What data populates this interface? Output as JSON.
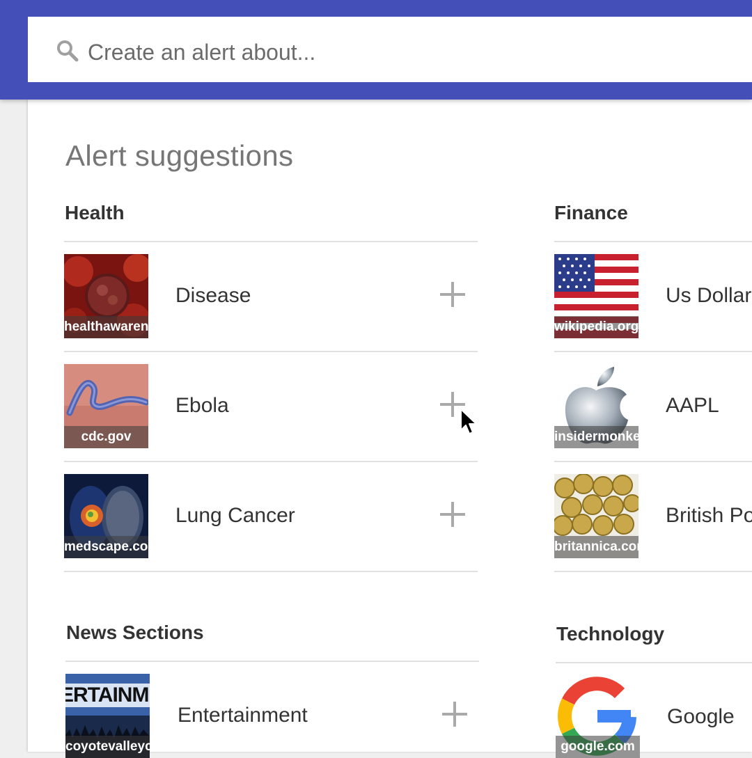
{
  "search": {
    "placeholder": "Create an alert about..."
  },
  "page": {
    "title": "Alert suggestions"
  },
  "categories": {
    "health": {
      "title": "Health",
      "items": [
        {
          "label": "Disease",
          "source": "healthawareness"
        },
        {
          "label": "Ebola",
          "source": "cdc.gov"
        },
        {
          "label": "Lung Cancer",
          "source": "medscape.com"
        }
      ]
    },
    "finance": {
      "title": "Finance",
      "items": [
        {
          "label": "Us Dollar",
          "source": "wikipedia.org"
        },
        {
          "label": "AAPL",
          "source": "insidermonkey"
        },
        {
          "label": "British Pound",
          "source": "britannica.com"
        }
      ]
    },
    "news": {
      "title": "News Sections",
      "items": [
        {
          "label": "Entertainment",
          "source": "coyotevalleycafe",
          "image_text": "ERTAINM"
        }
      ]
    },
    "technology": {
      "title": "Technology",
      "items": [
        {
          "label": "Google",
          "source": "google.com"
        }
      ]
    }
  },
  "colors": {
    "header": "#4450b8",
    "plus": "#a9a9a9",
    "text": "#333333",
    "muted": "#767676"
  },
  "icons": {
    "search": "search-icon",
    "add": "plus-icon",
    "cursor": "mouse-pointer-icon"
  }
}
